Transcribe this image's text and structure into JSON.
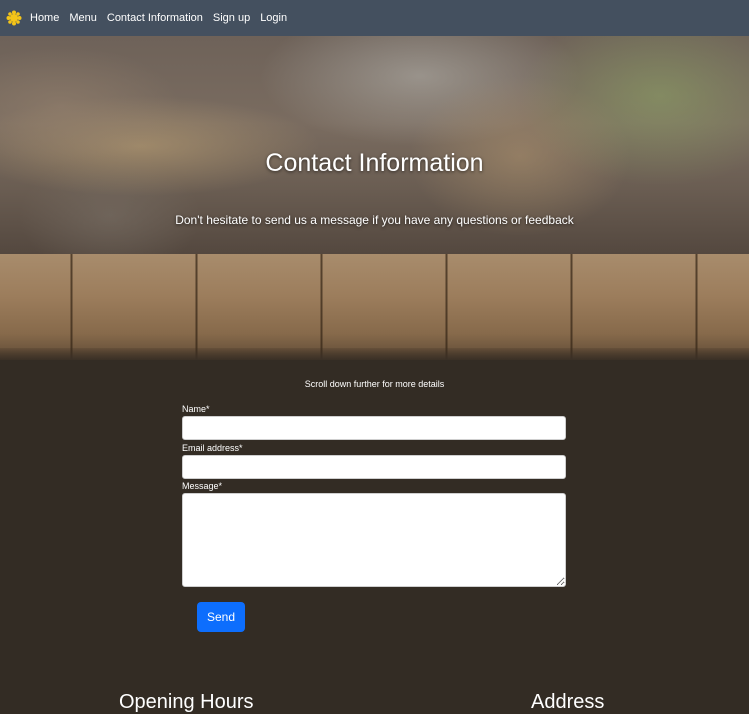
{
  "nav": {
    "logo_icon": "sun-logo-icon",
    "links": [
      {
        "label": "Home"
      },
      {
        "label": "Menu"
      },
      {
        "label": "Contact Information"
      },
      {
        "label": "Sign up"
      },
      {
        "label": "Login"
      }
    ]
  },
  "hero": {
    "title": "Contact Information",
    "subtitle": "Don't hesitate to send us a message if you have any questions or feedback"
  },
  "form": {
    "hint": "Scroll down further for more details",
    "name_label": "Name*",
    "name_value": "",
    "email_label": "Email address*",
    "email_value": "",
    "message_label": "Message*",
    "message_value": "",
    "send_label": "Send"
  },
  "sections": {
    "opening_hours": "Opening Hours",
    "address": "Address"
  },
  "colors": {
    "navbar": "#44505f",
    "background": "#332c24",
    "button": "#0d6efd",
    "logo": "#f5c518"
  }
}
